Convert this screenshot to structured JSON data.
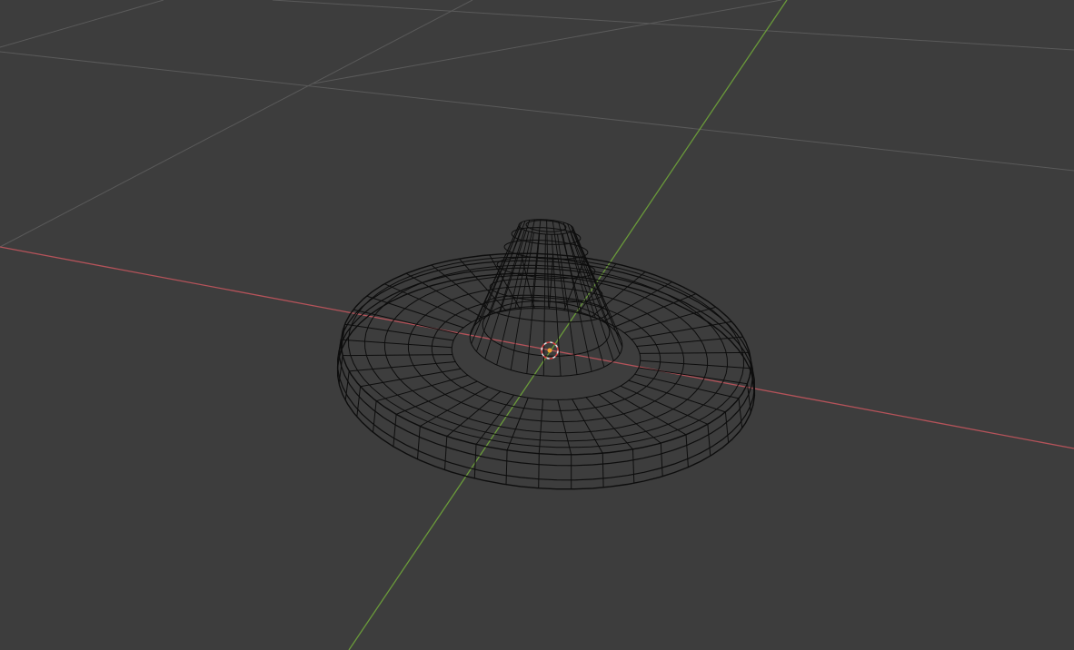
{
  "viewport": {
    "shading_mode": "wireframe",
    "background_color": "#3d3d3d",
    "grid_color": "#5a5a5a",
    "x_axis_color": "#b5535a",
    "y_axis_color": "#6a9a3a",
    "wire_color": "#0d0d0d",
    "origin_color": "#f0a030",
    "cursor_color": "#e0e0e0"
  },
  "object": {
    "type": "sombrero hat mesh",
    "icon": "3d-cursor-icon"
  }
}
